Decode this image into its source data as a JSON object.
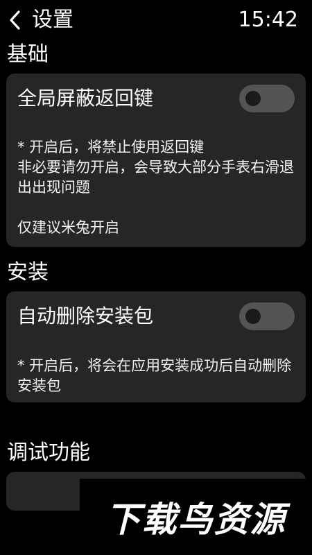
{
  "header": {
    "back_icon": "chevron-left-icon",
    "title": "设置",
    "time": "15:42"
  },
  "sections": {
    "basic": {
      "title": "基础",
      "toggle_label": "全局屏蔽返回键",
      "toggle_on": false,
      "desc_line1": "* 开启后，将禁止使用返回键",
      "desc_line2": "非必要请勿开启，会导致大部分手表右滑退出出现问题",
      "desc_line3": "仅建议米兔开启"
    },
    "install": {
      "title": "安装",
      "toggle_label": "自动删除安装包",
      "toggle_on": false,
      "desc": "* 开启后，将会在应用安装成功后自动删除安装包"
    },
    "debug": {
      "title": "调试功能"
    }
  },
  "watermark": {
    "text": "下载鸟资源"
  },
  "colors": {
    "background": "#000000",
    "card": "#262626",
    "toggle_track_off": "#545454",
    "toggle_knob": "#1a1a1a",
    "text": "#ffffff"
  }
}
